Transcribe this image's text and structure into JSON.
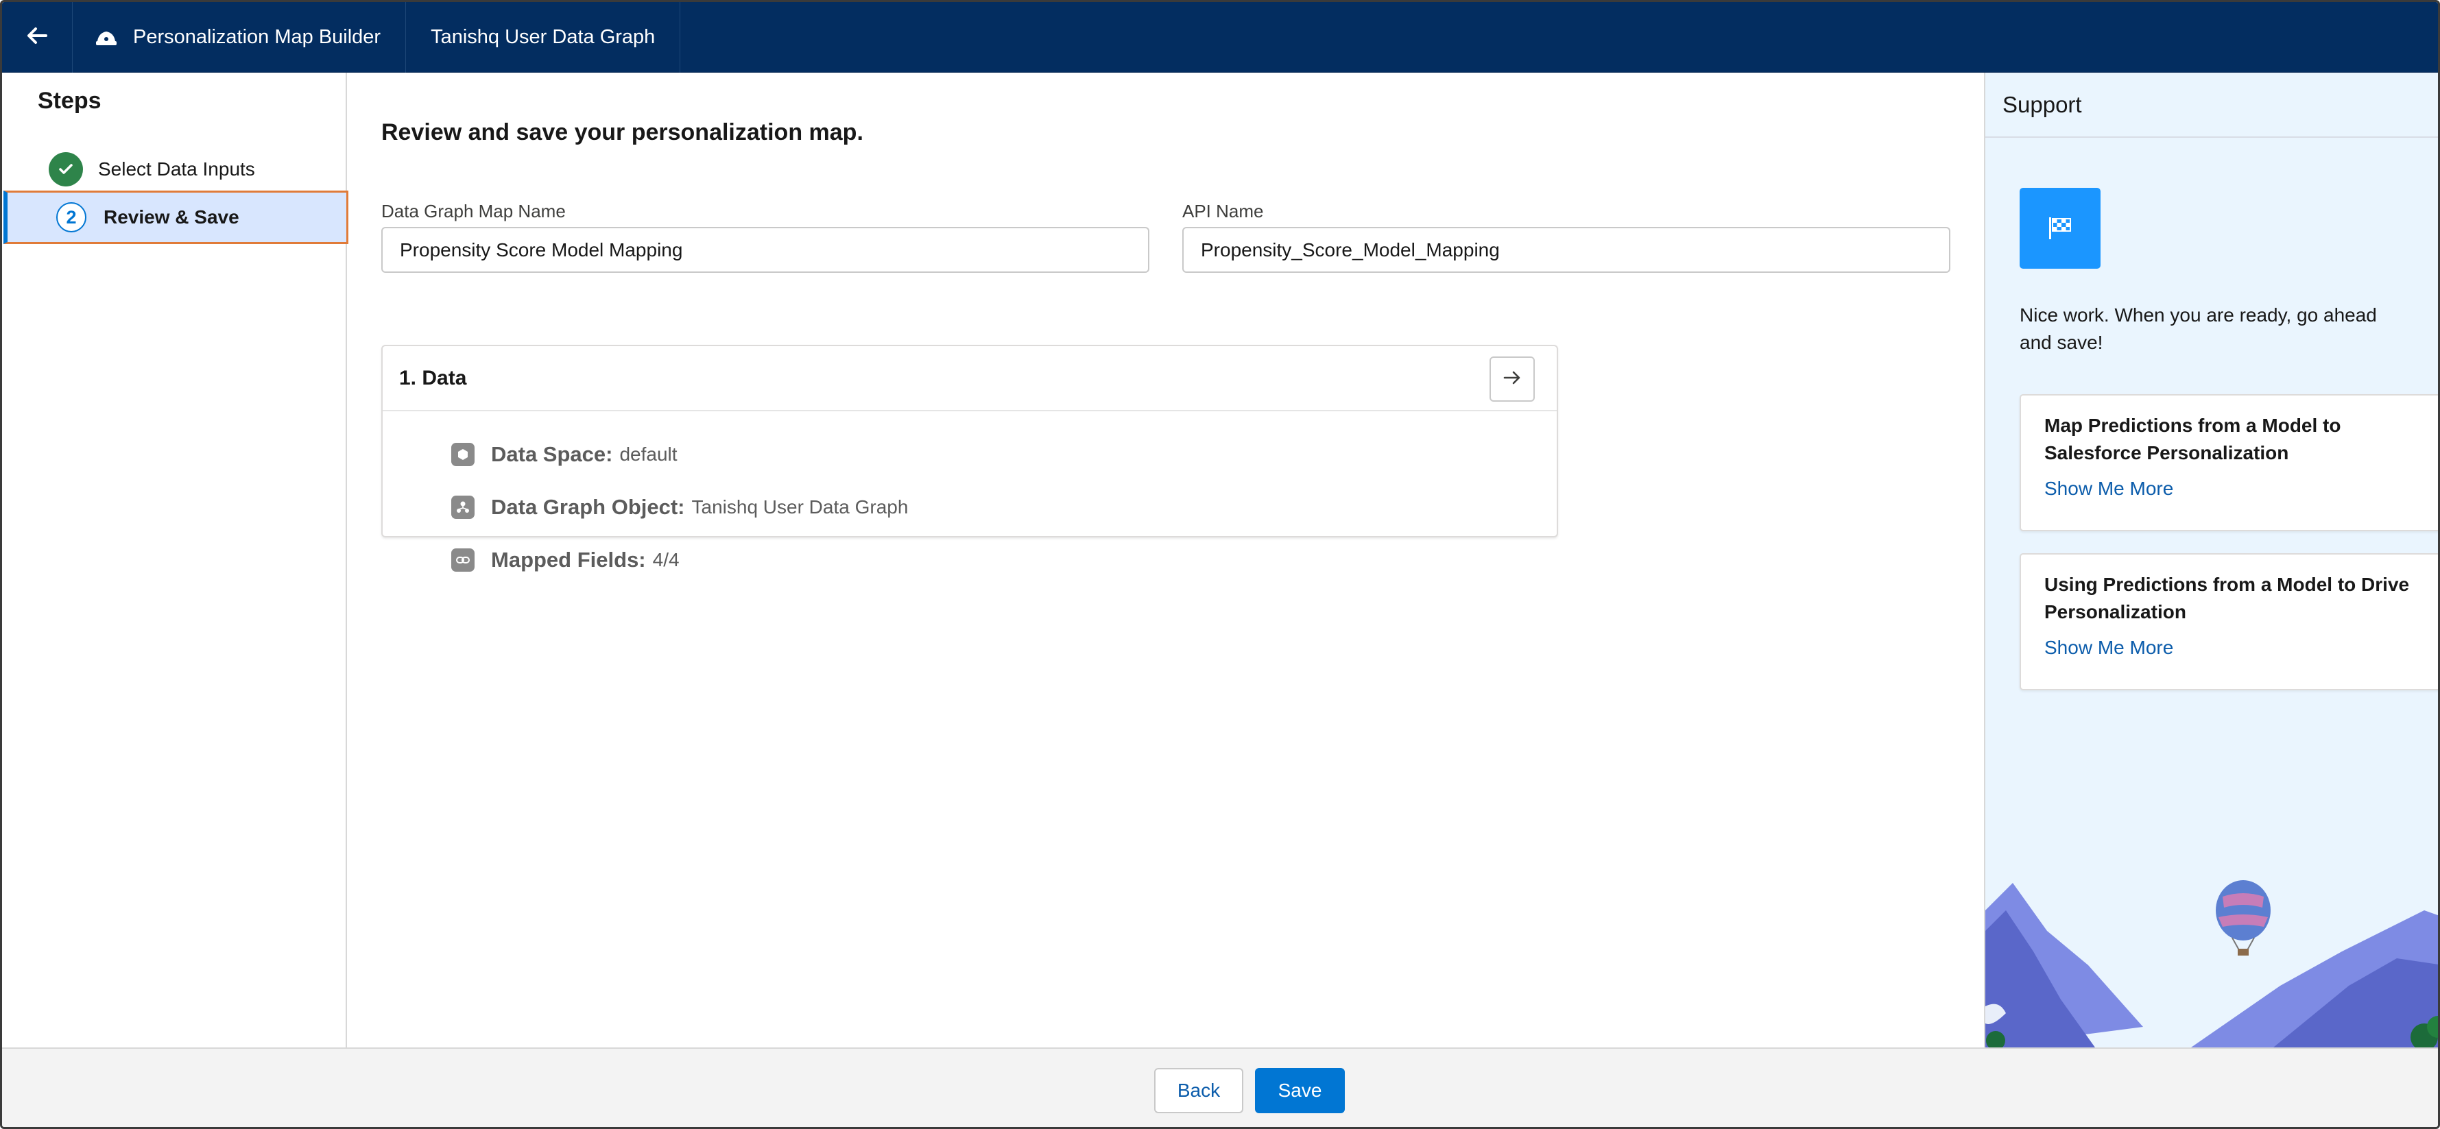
{
  "header": {
    "back_icon": "arrow-left-icon",
    "app_icon": "builder-icon",
    "app_title": "Personalization Map Builder",
    "record_title": "Tanishq User Data Graph",
    "background_color": "#032d60"
  },
  "steps": {
    "title": "Steps",
    "items": [
      {
        "label": "Select Data Inputs",
        "status": "complete",
        "icon": "check-icon"
      },
      {
        "label": "Review & Save",
        "status": "current",
        "number": "2"
      }
    ]
  },
  "main": {
    "title": "Review and save your personalization map.",
    "fields": {
      "map_name": {
        "label": "Data Graph Map Name",
        "value": "Propensity Score Model Mapping"
      },
      "api_name": {
        "label": "API Name",
        "value": "Propensity_Score_Model_Mapping"
      }
    },
    "card": {
      "title": "1. Data",
      "nav_icon": "arrow-right-icon",
      "details": [
        {
          "icon": "data-space-icon",
          "key": "Data Space:",
          "value": "default"
        },
        {
          "icon": "data-graph-icon",
          "key": "Data Graph Object:",
          "value": "Tanishq User Data Graph"
        },
        {
          "icon": "link-icon",
          "key": "Mapped Fields:",
          "value": "4/4"
        }
      ]
    }
  },
  "support": {
    "title": "Support",
    "badge_icon": "finish-flag-icon",
    "message": "Nice work. When you are ready, go ahead and save!",
    "cards": [
      {
        "title": "Map Predictions from a Model to Salesforce Personalization",
        "link": "Show Me More"
      },
      {
        "title": "Using Predictions from a Model to Drive Personalization",
        "link": "Show Me More"
      }
    ]
  },
  "footer": {
    "back_label": "Back",
    "save_label": "Save",
    "brand_color": "#0176d3"
  }
}
